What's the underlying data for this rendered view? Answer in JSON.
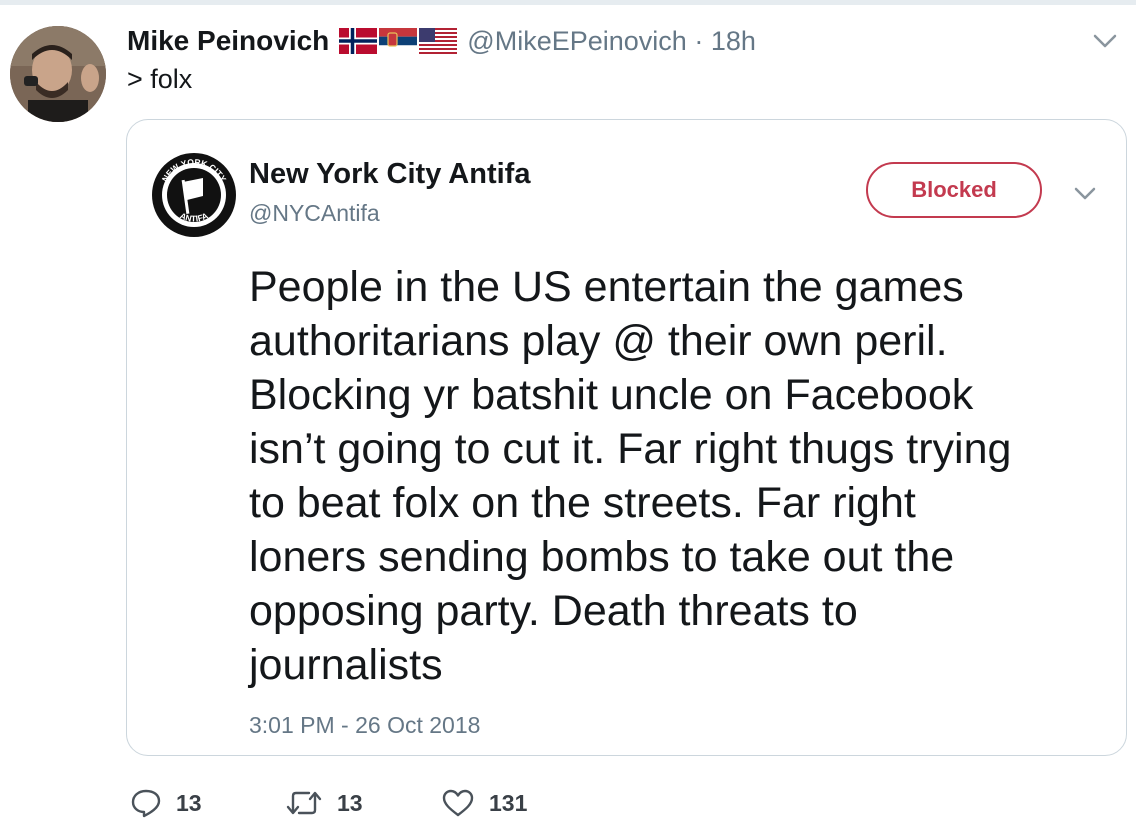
{
  "tweet": {
    "author_name": "Mike Peinovich",
    "author_flags": [
      "Norway flag",
      "Serbia flag",
      "United States flag"
    ],
    "author_handle": "@MikeEPeinovich",
    "separator": "·",
    "time_ago": "18h",
    "text": "> folx"
  },
  "quoted_tweet": {
    "author_name": "New York City Antifa",
    "author_handle": "@NYCAntifa",
    "avatar_text_top": "NEW YORK CITY",
    "avatar_text_bottom": "ANTIFA",
    "blocked_label": "Blocked",
    "lines": [
      "People in the US entertain the games",
      "authoritarians play @ their own peril.",
      "Blocking yr batshit uncle on Facebook",
      "isn’t going to cut it. Far right thugs trying",
      "to beat folx on the streets. Far right",
      "loners sending bombs to take out the",
      "opposing party. Death threats to",
      "journalists"
    ],
    "timestamp": "3:01 PM - 26 Oct 2018"
  },
  "actions": {
    "reply_count": "13",
    "retweet_count": "13",
    "like_count": "131"
  },
  "colors": {
    "blocked_red": "#c33a4f",
    "secondary_text": "#657786",
    "border": "#ccd6dd"
  }
}
